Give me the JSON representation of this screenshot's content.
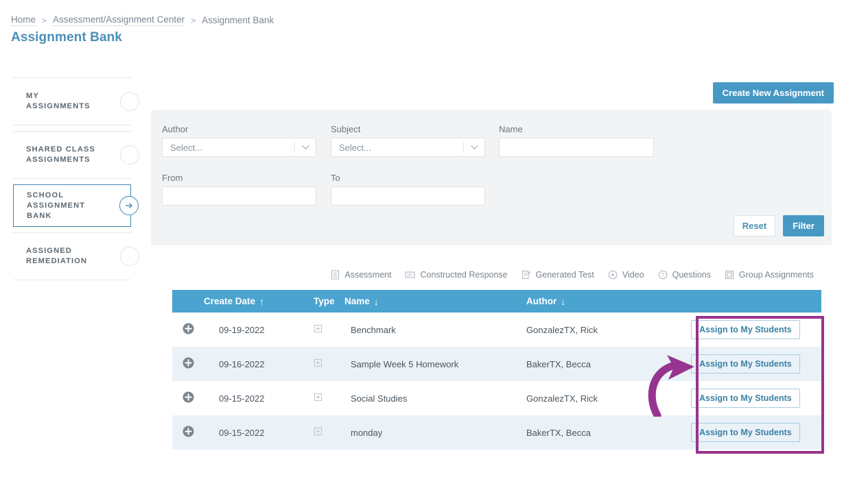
{
  "breadcrumb": {
    "items": [
      {
        "label": "Home",
        "link": true
      },
      {
        "label": "Assessment/Assignment Center",
        "link": true
      },
      {
        "label": "Assignment Bank",
        "link": false
      }
    ],
    "separator": ">"
  },
  "page_title": "Assignment Bank",
  "sidebar": {
    "items": [
      {
        "label": "MY ASSIGNMENTS",
        "active": false
      },
      {
        "label": "SHARED CLASS ASSIGNMENTS",
        "active": false
      },
      {
        "label": "SCHOOL ASSIGNMENT BANK",
        "active": true
      },
      {
        "label": "ASSIGNED REMEDIATION",
        "active": false
      }
    ]
  },
  "toolbar": {
    "create_label": "Create New Assignment"
  },
  "filters": {
    "author": {
      "label": "Author",
      "value": "Select...",
      "placeholder": "Select..."
    },
    "subject": {
      "label": "Subject",
      "value": "Select...",
      "placeholder": "Select..."
    },
    "name": {
      "label": "Name",
      "value": "",
      "placeholder": ""
    },
    "from": {
      "label": "From",
      "value": "",
      "placeholder": ""
    },
    "to": {
      "label": "To",
      "value": "",
      "placeholder": ""
    },
    "reset_label": "Reset",
    "filter_label": "Filter"
  },
  "legend": [
    {
      "label": "Assessment",
      "icon": "assessment-icon"
    },
    {
      "label": "Constructed Response",
      "icon": "constructed-response-icon"
    },
    {
      "label": "Generated Test",
      "icon": "generated-test-icon"
    },
    {
      "label": "Video",
      "icon": "video-icon"
    },
    {
      "label": "Questions",
      "icon": "questions-icon"
    },
    {
      "label": "Group Assignments",
      "icon": "group-assignments-icon"
    }
  ],
  "table": {
    "columns": [
      {
        "label": "",
        "sort": ""
      },
      {
        "label": "Create Date",
        "sort": "↑"
      },
      {
        "label": "Type",
        "sort": ""
      },
      {
        "label": "Name",
        "sort": "↓"
      },
      {
        "label": "Author",
        "sort": "↓"
      },
      {
        "label": "",
        "sort": ""
      }
    ],
    "rows": [
      {
        "create_date": "09-19-2022",
        "type_icon": "group-assignments-icon",
        "name": "Benchmark",
        "author": "GonzalezTX, Rick",
        "action_label": "Assign to My Students"
      },
      {
        "create_date": "09-16-2022",
        "type_icon": "group-assignments-icon",
        "name": "Sample Week 5 Homework",
        "author": "BakerTX, Becca",
        "action_label": "Assign to My Students"
      },
      {
        "create_date": "09-15-2022",
        "type_icon": "group-assignments-icon",
        "name": "Social Studies",
        "author": "GonzalezTX, Rick",
        "action_label": "Assign to My Students"
      },
      {
        "create_date": "09-15-2022",
        "type_icon": "group-assignments-icon",
        "name": "monday",
        "author": "BakerTX, Becca",
        "action_label": "Assign to My Students"
      }
    ]
  },
  "colors": {
    "accent_blue": "#4799c4",
    "header_blue": "#4ba3cf",
    "title_blue": "#4a8fb8",
    "annotation_magenta": "#96348f",
    "row_alt": "#eaf2f8",
    "panel_gray": "#f1f3f5"
  }
}
